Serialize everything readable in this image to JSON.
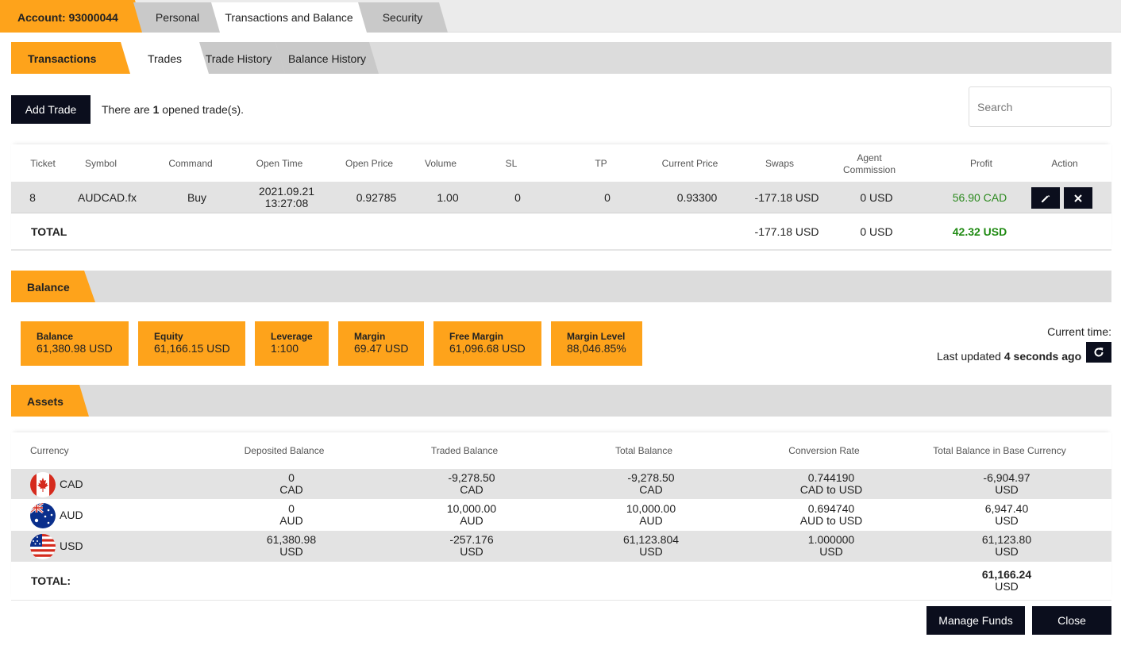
{
  "top_tabs": {
    "account": "Account: 93000044",
    "personal": "Personal",
    "transactions": "Transactions and Balance",
    "security": "Security"
  },
  "sub_tabs": {
    "transactions": "Transactions",
    "trades": "Trades",
    "trade_history": "Trade History",
    "balance_history": "Balance History"
  },
  "toolbar": {
    "add_trade": "Add Trade",
    "opened_prefix": "There are ",
    "opened_count": "1",
    "opened_suffix": " opened trade(s).",
    "search_placeholder": "Search"
  },
  "trades": {
    "headers": {
      "ticket": "Ticket",
      "symbol": "Symbol",
      "command": "Command",
      "open_time": "Open Time",
      "open_price": "Open Price",
      "volume": "Volume",
      "sl": "SL",
      "tp": "TP",
      "current_price": "Current Price",
      "swaps": "Swaps",
      "agent_1": "Agent",
      "agent_2": "Commission",
      "profit": "Profit",
      "action": "Action"
    },
    "row": {
      "ticket": "8",
      "symbol": "AUDCAD.fx",
      "command": "Buy",
      "open_date": "2021.09.21",
      "open_clock": "13:27:08",
      "open_price": "0.92785",
      "volume": "1.00",
      "sl": "0",
      "tp": "0",
      "current_price": "0.93300",
      "swaps": "-177.18 USD",
      "commission": "0 USD",
      "profit": "56.90 CAD"
    },
    "total": {
      "label": "TOTAL",
      "swaps": "-177.18 USD",
      "commission": "0 USD",
      "profit": "42.32 USD"
    }
  },
  "balance": {
    "title": "Balance",
    "cards": [
      {
        "title": "Balance",
        "value": "61,380.98 USD"
      },
      {
        "title": "Equity",
        "value": "61,166.15 USD"
      },
      {
        "title": "Leverage",
        "value": "1:100"
      },
      {
        "title": "Margin",
        "value": "69.47 USD"
      },
      {
        "title": "Free Margin",
        "value": "61,096.68 USD"
      },
      {
        "title": "Margin Level",
        "value": "88,046.85%"
      }
    ],
    "current_time": "Current time:",
    "last_updated_prefix": "Last updated ",
    "last_updated_value": "4 seconds ago"
  },
  "assets": {
    "title": "Assets",
    "headers": {
      "currency": "Currency",
      "deposited": "Deposited Balance",
      "traded": "Traded Balance",
      "total": "Total Balance",
      "rate": "Conversion Rate",
      "base": "Total Balance in Base Currency"
    },
    "rows": [
      {
        "currency": "CAD",
        "dep_v": "0",
        "dep_u": "CAD",
        "tr_v": "-9,278.50",
        "tr_u": "CAD",
        "tot_v": "-9,278.50",
        "tot_u": "CAD",
        "rate_v": "0.744190",
        "rate_u": "CAD to USD",
        "base_v": "-6,904.97",
        "base_u": "USD"
      },
      {
        "currency": "AUD",
        "dep_v": "0",
        "dep_u": "AUD",
        "tr_v": "10,000.00",
        "tr_u": "AUD",
        "tot_v": "10,000.00",
        "tot_u": "AUD",
        "rate_v": "0.694740",
        "rate_u": "AUD to USD",
        "base_v": "6,947.40",
        "base_u": "USD"
      },
      {
        "currency": "USD",
        "dep_v": "61,380.98",
        "dep_u": "USD",
        "tr_v": "-257.176",
        "tr_u": "USD",
        "tot_v": "61,123.804",
        "tot_u": "USD",
        "rate_v": "1.000000",
        "rate_u": "USD",
        "base_v": "61,123.80",
        "base_u": "USD"
      }
    ],
    "total": {
      "label": "TOTAL:",
      "value": "61,166.24",
      "unit": "USD"
    }
  },
  "footer": {
    "manage_funds": "Manage Funds",
    "close": "Close"
  },
  "colors": {
    "accent": "#fea31b",
    "dark_button": "#0b0e1d",
    "profit_green": "#2c8a1f"
  },
  "icons": {
    "edit": "pencil-icon",
    "delete": "close-icon",
    "refresh": "refresh-icon"
  }
}
